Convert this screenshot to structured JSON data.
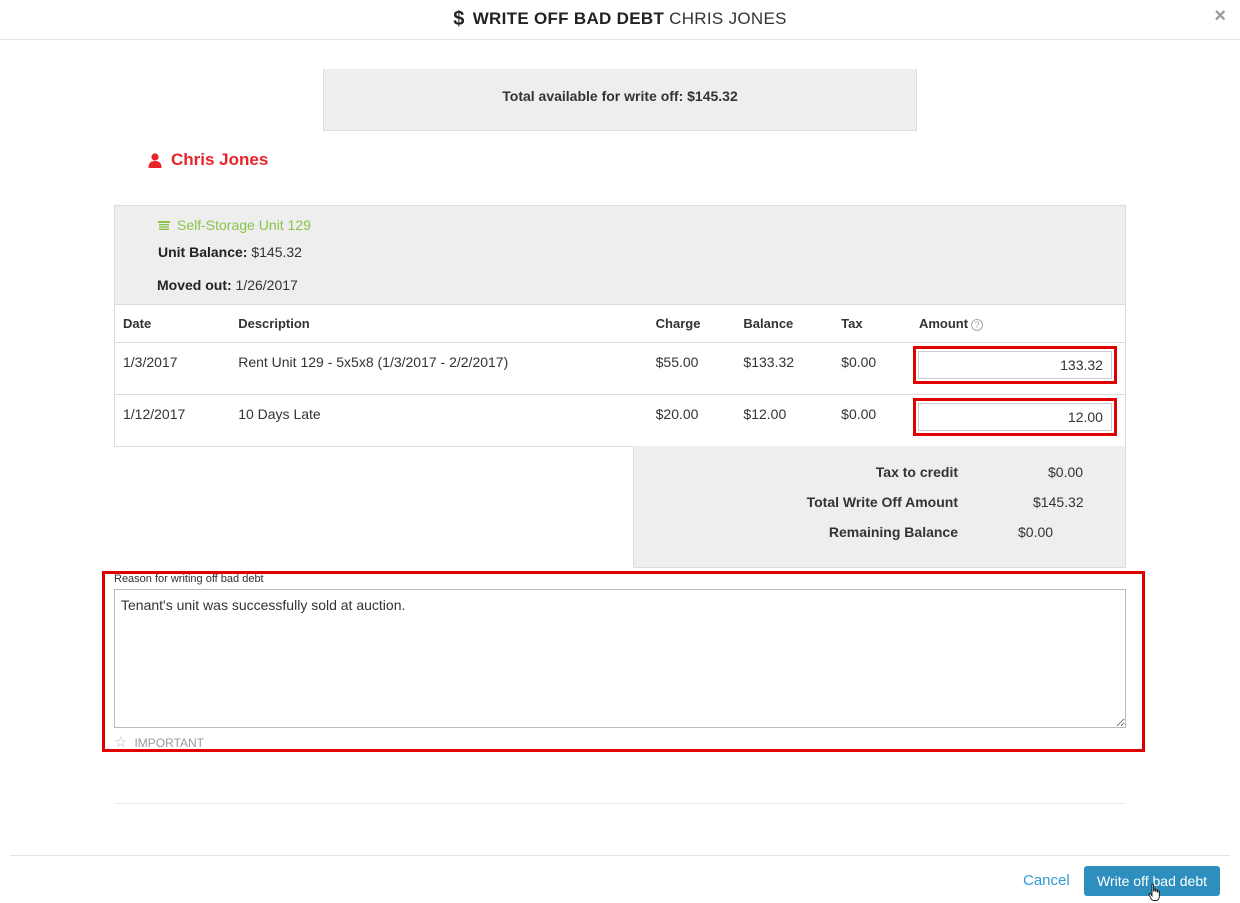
{
  "modal": {
    "title_strong": "WRITE OFF BAD DEBT",
    "title_light": "CHRIS JONES",
    "title_icon": "dollar-icon",
    "close_label": "×"
  },
  "summary_top": {
    "label": "Total available for write off:",
    "value": "$145.32"
  },
  "tenant": {
    "name": "Chris Jones",
    "icon": "person-icon",
    "color": "#e8232a"
  },
  "unit": {
    "name": "Self-Storage Unit 129",
    "icon": "storage-unit-icon",
    "color": "#8bc34a",
    "balance_label": "Unit Balance:",
    "balance_value": "$145.32",
    "moved_out_label": "Moved out:",
    "moved_out_value": "1/26/2017"
  },
  "table": {
    "headers": {
      "date": "Date",
      "description": "Description",
      "charge": "Charge",
      "balance": "Balance",
      "tax": "Tax",
      "amount": "Amount"
    },
    "rows": [
      {
        "date": "1/3/2017",
        "description": "Rent Unit 129 - 5x5x8 (1/3/2017 - 2/2/2017)",
        "charge": "$55.00",
        "balance": "$133.32",
        "tax": "$0.00",
        "amount": "133.32"
      },
      {
        "date": "1/12/2017",
        "description": "10 Days Late",
        "charge": "$20.00",
        "balance": "$12.00",
        "tax": "$0.00",
        "amount": "12.00"
      }
    ]
  },
  "totals": {
    "tax_label": "Tax to credit",
    "tax_value": "$0.00",
    "total_label": "Total Write Off Amount",
    "total_value": "$145.32",
    "remaining_label": "Remaining Balance",
    "remaining_value": "$0.00"
  },
  "reason": {
    "label": "Reason for writing off bad debt",
    "value": "Tenant's unit was successfully sold at auction.",
    "important_label": "IMPORTANT",
    "important_icon": "star-icon"
  },
  "footer": {
    "cancel_label": "Cancel",
    "submit_label": "Write off bad debt",
    "accent_color": "#2e8fbf"
  }
}
